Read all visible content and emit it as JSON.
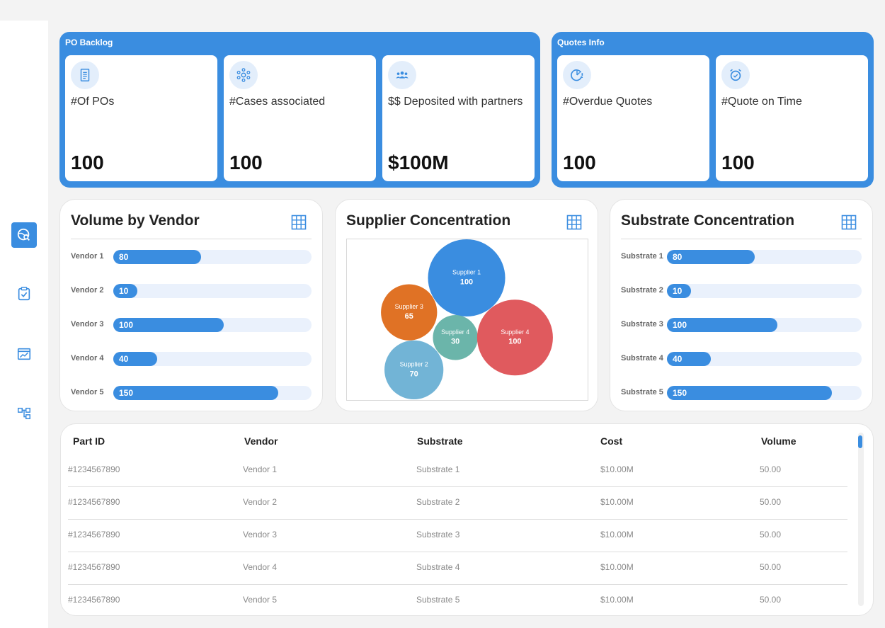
{
  "po_backlog": {
    "title": "PO Backlog",
    "cards": [
      {
        "label": "#Of POs",
        "value": "100",
        "icon": "document-icon"
      },
      {
        "label": "#Cases associated",
        "value": "100",
        "icon": "network-icon"
      },
      {
        "label": "$$ Deposited with partners",
        "value": "$100M",
        "icon": "group-icon"
      }
    ]
  },
  "quotes_info": {
    "title": "Quotes Info",
    "cards": [
      {
        "label": "#Overdue Quotes",
        "value": "100",
        "icon": "clock-alert-icon"
      },
      {
        "label": "#Quote on Time",
        "value": "100",
        "icon": "alarm-check-icon"
      }
    ]
  },
  "volume_by_vendor": {
    "title": "Volume by Vendor",
    "chart_data": {
      "type": "bar",
      "orientation": "horizontal",
      "categories": [
        "Vendor 1",
        "Vendor 2",
        "Vendor 3",
        "Vendor 4",
        "Vendor 5"
      ],
      "values": [
        80,
        10,
        100,
        40,
        150
      ],
      "xlim": [
        0,
        180
      ]
    }
  },
  "supplier_concentration": {
    "title": "Supplier Concentration",
    "chart_data": {
      "type": "bubble",
      "points": [
        {
          "label": "Supplier 1",
          "value": 100,
          "color": "#3a8de0"
        },
        {
          "label": "Supplier 2",
          "value": 70,
          "color": "#72b4d6"
        },
        {
          "label": "Supplier 3",
          "value": 65,
          "color": "#e07225"
        },
        {
          "label": "Supplier 4",
          "value": 30,
          "color": "#6bb5aa"
        },
        {
          "label": "Supplier 4",
          "value": 100,
          "color": "#e05a5e"
        }
      ]
    }
  },
  "substrate_concentration": {
    "title": "Substrate Concentration",
    "chart_data": {
      "type": "bar",
      "orientation": "horizontal",
      "categories": [
        "Substrate 1",
        "Substrate 2",
        "Substrate 3",
        "Substrate 4",
        "Substrate 5"
      ],
      "values": [
        80,
        10,
        100,
        40,
        150
      ],
      "xlim": [
        0,
        180
      ]
    }
  },
  "table": {
    "headers": [
      "Part ID",
      "Vendor",
      "Substrate",
      "Cost",
      "Volume"
    ],
    "rows": [
      [
        "#1234567890",
        "Vendor 1",
        "Substrate 1",
        "$10.00M",
        "50.00"
      ],
      [
        "#1234567890",
        "Vendor 2",
        "Substrate 2",
        "$10.00M",
        "50.00"
      ],
      [
        "#1234567890",
        "Vendor 3",
        "Substrate 3",
        "$10.00M",
        "50.00"
      ],
      [
        "#1234567890",
        "Vendor 4",
        "Substrate 4",
        "$10.00M",
        "50.00"
      ],
      [
        "#1234567890",
        "Vendor 5",
        "Substrate 5",
        "$10.00M",
        "50.00"
      ]
    ]
  },
  "sidebar": {
    "items": [
      {
        "icon": "global-search-icon",
        "active": true
      },
      {
        "icon": "clipboard-check-icon",
        "active": false
      },
      {
        "icon": "chart-window-icon",
        "active": false
      },
      {
        "icon": "hierarchy-icon",
        "active": false
      }
    ]
  },
  "colors": {
    "accent": "#3a8de0",
    "track": "#eaf1fc",
    "background": "#f3f3f3"
  }
}
